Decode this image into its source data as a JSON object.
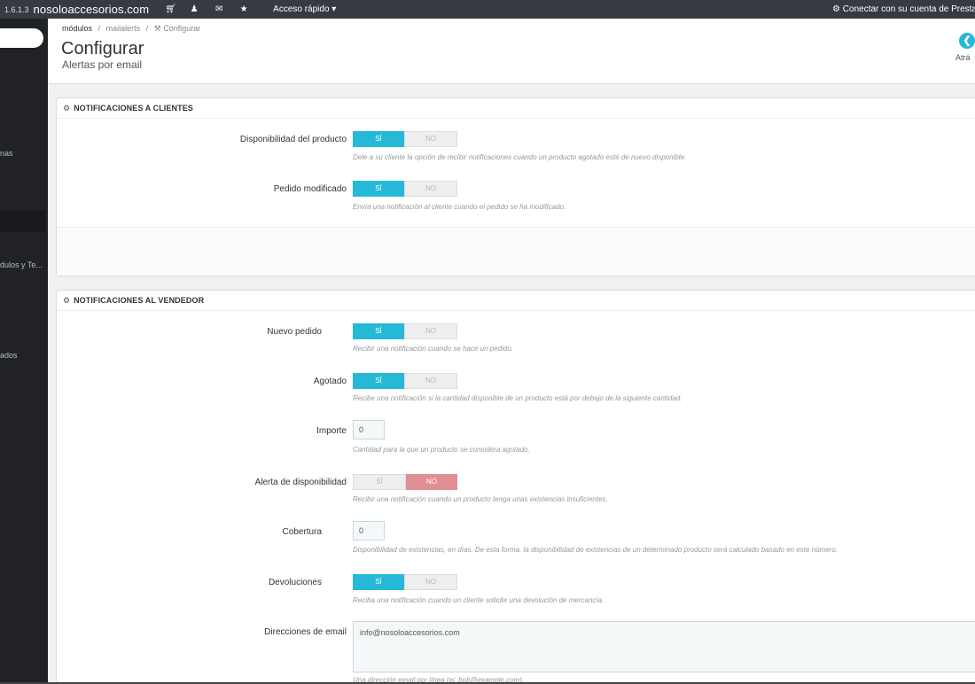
{
  "topbar": {
    "version": "1.6.1.3",
    "shop_name": "nosoloaccesorios.com",
    "icons": [
      "cart-icon",
      "user-icon",
      "envelope-icon",
      "trophy-icon"
    ],
    "quick_access": "Acceso rápido ▾",
    "connect": "Conectar con su cuenta de Presta"
  },
  "sidebar": {
    "items": [
      {
        "label": "nas"
      },
      {
        "label": "dulos y Te..."
      },
      {
        "label": "ados"
      }
    ]
  },
  "header": {
    "breadcrumb": [
      "módulos",
      "mailalerts",
      "Configurar"
    ],
    "breadcrumb_sep": "/",
    "title": "Configurar",
    "subtitle": "Alertas por email",
    "back_label": "Atrá"
  },
  "panel_clients": {
    "title": "NOTIFICACIONES A CLIENTES",
    "rows": [
      {
        "label": "Disponibilidad del producto",
        "on": "SÍ",
        "off": "NO",
        "value": "on",
        "help": "Dele a su cliente la opción de recibir notificaciones cuando un producto agotado esté de nuevo disponible."
      },
      {
        "label": "Pedido modificado",
        "on": "SÍ",
        "off": "NO",
        "value": "on",
        "help": "Envía una notificación al cliente cuando el pedido se ha modificado."
      }
    ]
  },
  "panel_vendor": {
    "title": "NOTIFICACIONES AL VENDEDOR",
    "new_order": {
      "label": "Nuevo pedido",
      "on": "SÍ",
      "off": "NO",
      "value": "on",
      "help": "Recibir una notificación cuando se hace un pedido."
    },
    "out_of_stock": {
      "label": "Agotado",
      "on": "SÍ",
      "off": "NO",
      "value": "on",
      "help": "Recibe una notificación si la cantidad disponible de un producto está por debajo de la siguiente cantidad."
    },
    "amount": {
      "label": "Importe",
      "value": "0",
      "help": "Cantidad para la que un producto se considera agotado."
    },
    "stock_alert": {
      "label": "Alerta de disponibilidad",
      "on": "SÍ",
      "off": "NO",
      "value": "off",
      "help": "Recibir una notificación cuando un producto tenga unas existencias insuficientes."
    },
    "coverage": {
      "label": "Cobertura",
      "value": "0",
      "help": "Disponibilidad de existencias, en días. De esta forma, la disponibilidad de existencias de un determinado producto será calculado basado en este número."
    },
    "returns": {
      "label": "Devoluciones",
      "on": "SÍ",
      "off": "NO",
      "value": "on",
      "help": "Reciba una notificación cuando un cliente solicite una devolución de mercancía."
    },
    "emails": {
      "label": "Direcciones de email",
      "value": "info@nosoloaccesorios.com",
      "help": "Una dirección email por línea (ej. bob@example.com)."
    }
  },
  "colors": {
    "accent": "#25b9d7",
    "danger": "#e08f95",
    "topbar": "#363a41",
    "sidebar": "#202226"
  }
}
